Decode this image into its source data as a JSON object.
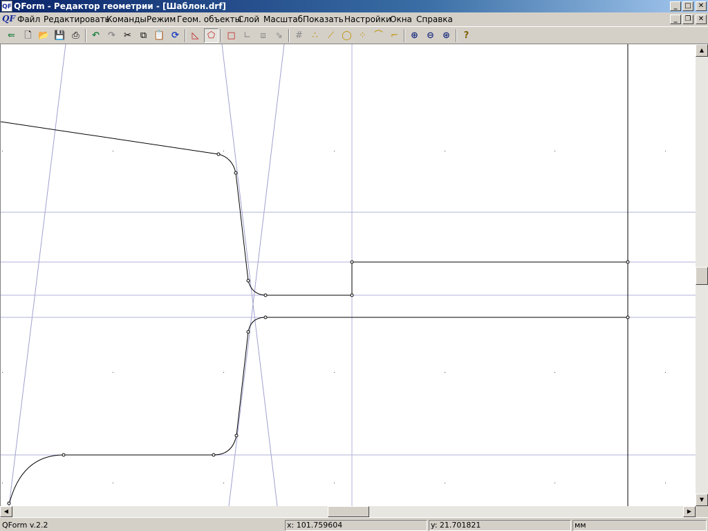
{
  "window": {
    "title": "QForm - Редактор геометрии - [Шаблон.drf]",
    "icon_text": "QF",
    "controls": {
      "minimize": "_",
      "maximize": "□",
      "close": "✕"
    }
  },
  "menubar": {
    "doc_icon_text": "QF",
    "items": [
      "Файл",
      "Редактировать",
      "Команды",
      "Режим",
      "Геом. объекты",
      "Слой",
      "Масштаб",
      "Показать",
      "Настройки",
      "Окна",
      "Справка"
    ],
    "mdi_controls": {
      "minimize": "_",
      "restore": "❐",
      "close": "✕"
    }
  },
  "toolbar": {
    "buttons": [
      {
        "icon": "exit-icon",
        "glyph": "⇚"
      },
      {
        "icon": "new-file-icon",
        "glyph": "🗋"
      },
      {
        "icon": "open-folder-icon",
        "glyph": "📂"
      },
      {
        "icon": "save-icon",
        "glyph": "💾"
      },
      {
        "icon": "print-icon",
        "glyph": "⎙"
      },
      {
        "icon": "undo-icon",
        "glyph": "↶"
      },
      {
        "icon": "redo-icon",
        "glyph": "↷"
      },
      {
        "icon": "cut-icon",
        "glyph": "✂"
      },
      {
        "icon": "copy-icon",
        "glyph": "⧉"
      },
      {
        "icon": "paste-icon",
        "glyph": "📋"
      },
      {
        "icon": "refresh-icon",
        "glyph": "⟳"
      },
      {
        "icon": "draw-contour-icon",
        "glyph": "◺"
      },
      {
        "icon": "draw-arc-contour-icon",
        "glyph": "⬠"
      },
      {
        "icon": "rectangle-icon",
        "glyph": "□"
      },
      {
        "icon": "corner-icon",
        "glyph": "∟"
      },
      {
        "icon": "move-icon",
        "glyph": "⧈"
      },
      {
        "icon": "select-arrow-icon",
        "glyph": "⇘"
      },
      {
        "icon": "grid-lines-icon",
        "glyph": "#"
      },
      {
        "icon": "points-icon",
        "glyph": "∴"
      },
      {
        "icon": "line-icon",
        "glyph": "⟋"
      },
      {
        "icon": "circle-icon",
        "glyph": "◯"
      },
      {
        "icon": "dotted-circle-icon",
        "glyph": "⁘"
      },
      {
        "icon": "arc-icon",
        "glyph": "⌒"
      },
      {
        "icon": "fillet-icon",
        "glyph": "⌐"
      },
      {
        "icon": "zoom-in-icon",
        "glyph": "⊕"
      },
      {
        "icon": "zoom-out-icon",
        "glyph": "⊖"
      },
      {
        "icon": "zoom-all-icon",
        "glyph": "⊛"
      },
      {
        "icon": "help-icon",
        "glyph": "?"
      }
    ]
  },
  "statusbar": {
    "version": "QForm v.2.2",
    "x": "x: 101.759604",
    "y": "y: 21.701821",
    "units": "мм"
  },
  "colors": {
    "title_start": "#0a246a",
    "title_end": "#a6caf0",
    "grid_line": "#8080c0",
    "construction_line": "#a0a0d0",
    "geometry": "#000000"
  }
}
